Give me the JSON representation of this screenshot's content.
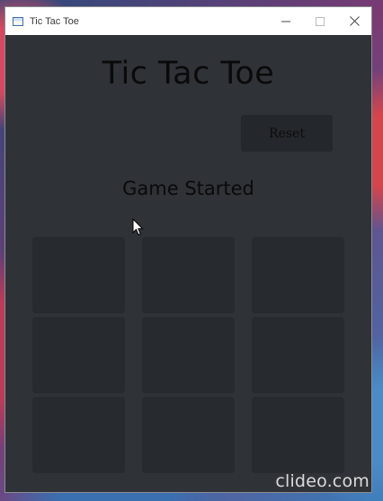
{
  "window": {
    "title": "Tic Tac Toe",
    "controls": {
      "minimize_icon": "minimize-icon",
      "maximize_icon": "maximize-icon",
      "close_icon": "close-icon"
    }
  },
  "app": {
    "heading": "Tic Tac Toe",
    "reset_label": "Reset",
    "status": "Game Started"
  },
  "board": {
    "rows": 3,
    "cols": 3,
    "cells": [
      "",
      "",
      "",
      "",
      "",
      "",
      "",
      "",
      ""
    ]
  },
  "colors": {
    "background": "#2f3237",
    "cell": "#272a2e",
    "button": "#24272b",
    "text": "#0a0a0a"
  },
  "watermark": "clideo.com"
}
